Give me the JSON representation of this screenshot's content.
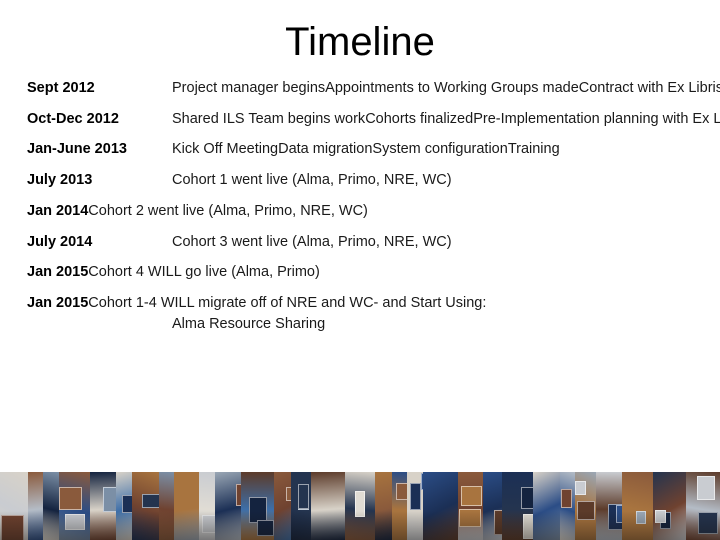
{
  "slide": {
    "title": "Timeline",
    "background_color": "#ffffff",
    "text_color": "#1a1a1a"
  },
  "timeline": {
    "rows": [
      {
        "label": "Sept 2012",
        "label_style": "tabbed",
        "lines": [
          "Project manager begins",
          "Appointments to Working Groups made",
          "Contract with Ex Libris signed"
        ]
      },
      {
        "label": "Oct-Dec 2012",
        "label_style": "tabbed",
        "lines": [
          "Shared ILS Team begins work",
          "Cohorts finalized",
          "Pre-Implementation planning with Ex Libris begins"
        ]
      },
      {
        "label": "Jan-June 2013",
        "label_style": "tabbed",
        "lines": [
          "Kick Off Meeting",
          "Data migration",
          "System configuration",
          "Training"
        ]
      },
      {
        "label": "July 2013",
        "label_style": "tabbed",
        "lines": [
          "Cohort 1 went live (Alma, Primo, NRE, WC)"
        ]
      },
      {
        "label": "Jan 2014",
        "label_style": "tight",
        "lines": [
          "Cohort 2 went live (Alma, Primo, NRE, WC)"
        ]
      },
      {
        "label": "July 2014",
        "label_style": "tabbed",
        "lines": [
          "Cohort 3 went live (Alma, Primo, NRE, WC)"
        ]
      },
      {
        "label": "Jan 2015",
        "label_style": "tight",
        "lines": [
          "Cohort 4 WILL go live (Alma, Primo)"
        ]
      },
      {
        "label": "Jan 2015",
        "label_style": "tight",
        "lines": [
          "Cohort 1-4 WILL migrate off of NRE and WC- and Start Using:"
        ],
        "continuation": "Alma Resource Sharing"
      }
    ]
  },
  "footer_image": {
    "description": "photo-collage-strip-of-campus-library-buildings",
    "palette": [
      "#2b4d86",
      "#1b2f55",
      "#8a5a3c",
      "#6f4230",
      "#c9ccd1",
      "#3d6ea8",
      "#9aa7b5",
      "#5c3b2a",
      "#d8d2c8",
      "#24344f",
      "#7b8fa6",
      "#a8743f",
      "#e0dcd4",
      "#14233f",
      "#b4bcc6"
    ]
  }
}
